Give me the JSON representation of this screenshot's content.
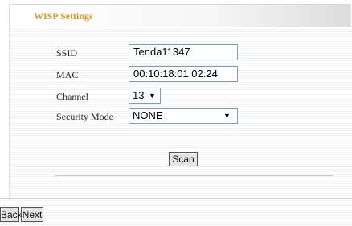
{
  "header": {
    "title": "WISP Settings"
  },
  "form": {
    "ssid": {
      "label": "SSID",
      "value": "Tenda11347"
    },
    "mac": {
      "label": "MAC",
      "value": "00:10:18:01:02:24"
    },
    "channel": {
      "label": "Channel",
      "value": "13"
    },
    "security_mode": {
      "label": "Security Mode",
      "value": "NONE"
    }
  },
  "buttons": {
    "scan": "Scan",
    "back": "Back",
    "next": "Next"
  }
}
